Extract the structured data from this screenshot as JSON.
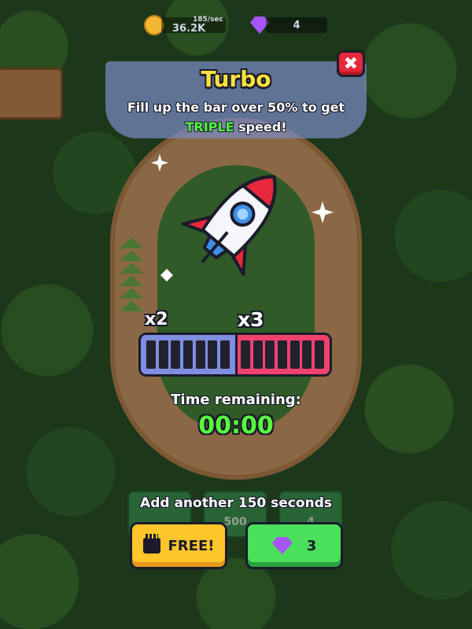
{
  "hud": {
    "coin_rate": "185/sec",
    "coins": "36.2K",
    "gems": "4"
  },
  "popup": {
    "title": "Turbo",
    "subtitle_parts": [
      "Fill up the bar over 50% to get",
      "TRIPLE",
      "speed!"
    ],
    "multiplier_low": "x2",
    "multiplier_high": "x3",
    "bar_fill_fraction": 0.0,
    "time_label": "Time remaining:",
    "time_value": "00:00",
    "add_time_label": "Add another 150 seconds",
    "free_button": "FREE!",
    "gem_button_cost": "3"
  },
  "shop": {
    "coin_card_value": "500",
    "gem_card_value": "4"
  },
  "colors": {
    "title": "#ffe23d",
    "highlight": "#4cff3e",
    "bar_low": "#7e8ee0",
    "bar_high": "#f1426e",
    "free_button": "#ffc62b",
    "gem_button": "#4be05c",
    "close_button": "#e8283b"
  },
  "icons": [
    "coin-icon",
    "gem-icon",
    "close-icon",
    "rocket-icon",
    "sparkle-icon",
    "video-ad-icon"
  ]
}
